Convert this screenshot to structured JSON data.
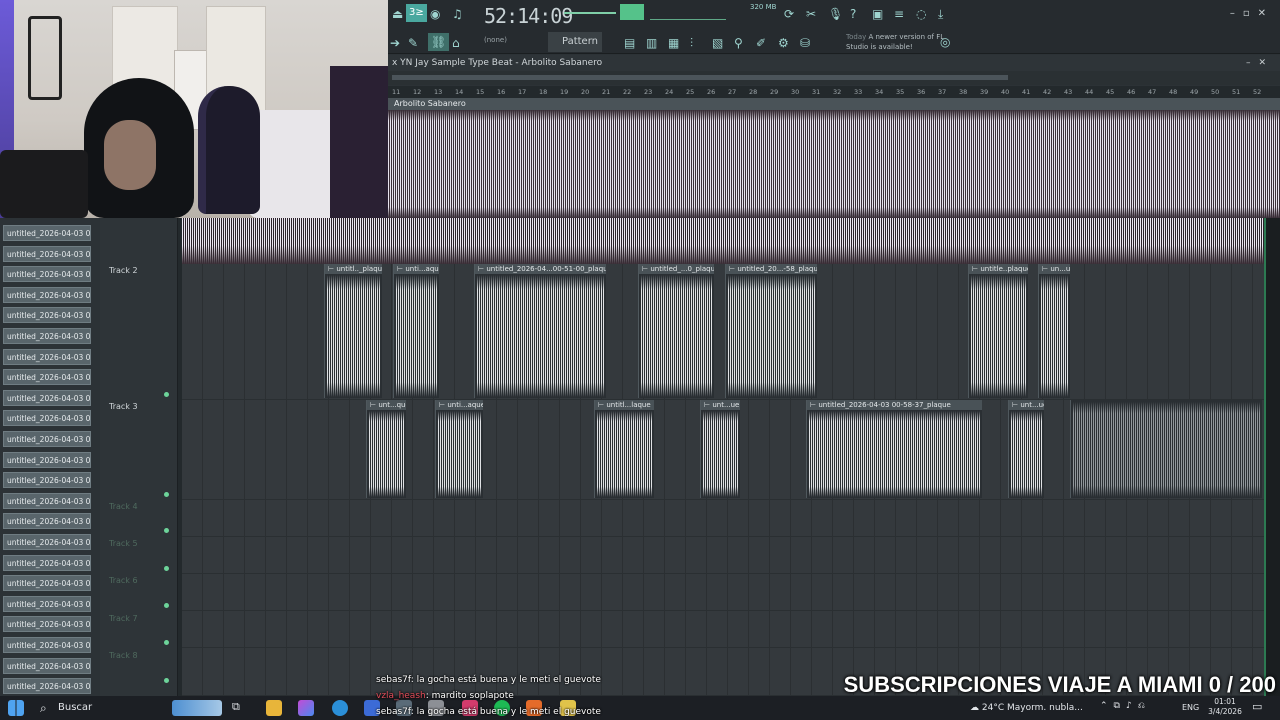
{
  "fl": {
    "clock": "52:14:09",
    "cpu_mem": "320 MB",
    "pattern": "Pattern 1",
    "snap": "(none)",
    "notice_today": "Today",
    "notice_text": "A newer version of FL Studio is available!",
    "playlist_title": "x YN Jay Sample Type Beat - Arbolito Sabanero",
    "main_track_label": "Arbolito Sabanero",
    "ruler": [
      "11",
      "12",
      "13",
      "14",
      "15",
      "16",
      "17",
      "18",
      "19",
      "20",
      "21",
      "22",
      "23",
      "24",
      "25",
      "26",
      "27",
      "28",
      "29",
      "30",
      "31",
      "32",
      "33",
      "34",
      "35",
      "36",
      "37",
      "38",
      "39",
      "40",
      "41",
      "42",
      "43",
      "44",
      "45",
      "46",
      "47",
      "48",
      "49",
      "50",
      "51",
      "52"
    ]
  },
  "clip_browser": {
    "items": [
      "untitled_2026-04-03 00-",
      "untitled_2026-04-03 00-",
      "untitled_2026-04-03 00-",
      "untitled_2026-04-03 00-",
      "untitled_2026-04-03 00-",
      "untitled_2026-04-03 00-",
      "untitled_2026-04-03 00-",
      "untitled_2026-04-03 00-",
      "untitled_2026-04-03 00-",
      "untitled_2026-04-03 00-",
      "untitled_2026-04-03 00-",
      "untitled_2026-04-03 00-",
      "untitled_2026-04-03 00-",
      "untitled_2026-04-03 00-",
      "untitled_2026-04-03 00-",
      "untitled_2026-04-03 00-",
      "untitled_2026-04-03 00-",
      "untitled_2026-04-03 00-",
      "untitled_2026-04-03 00-",
      "untitled_2026-04-03 00-",
      "untitled_2026-04-03 00-",
      "untitled_2026-04-03 00-",
      "untitled_2026-04-03 00-"
    ]
  },
  "tracks": {
    "t2": "Track 2",
    "t3": "Track 3",
    "t4": "Track 4",
    "t5": "Track 5",
    "t6": "Track 6",
    "t7": "Track 7",
    "t8": "Track 8"
  },
  "track2_clips": [
    "untitl.._plaque",
    "unti...aque",
    "untitled_2026-04...00-51-00_plaque",
    "untitled_...0_plaque",
    "untitled_20...-58_plaque",
    "untitle..plaque",
    "un...ue"
  ],
  "track3_clips": [
    "unt...que",
    "unti...aque",
    "untitl...laque",
    "unt...ue",
    "untitled_2026-04-03 00-58-37_plaque",
    "unt...ue"
  ],
  "chat": {
    "line1_user": "sebas7f",
    "line1_msg": ": la gocha está buena y le meti el guevote",
    "line2_user": "vzla_heash",
    "line2_msg": ": mardito soplapote",
    "line3_user": "sebas7f",
    "line3_msg": ": la gocha está buena y le meti el guevote"
  },
  "overlay": {
    "subs_goal": "SUBSCRIPCIONES VIAJE A MIAMI 0 / 200"
  },
  "taskbar": {
    "search": "Buscar",
    "weather": "24°C  Mayorm. nubla...",
    "lang": "ENG",
    "time": "01:01",
    "date": "3/4/2026"
  }
}
